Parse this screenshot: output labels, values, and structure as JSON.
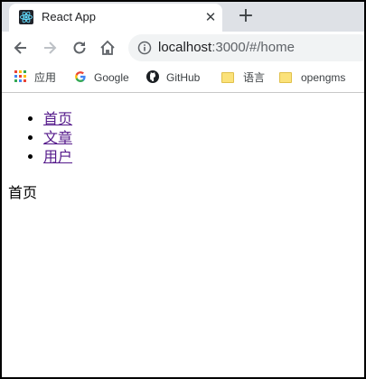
{
  "tab": {
    "title": "React App",
    "close": "✕"
  },
  "new_tab": "+",
  "address": {
    "host": "localhost",
    "rest": ":3000/#/home"
  },
  "bookmarks": [
    {
      "label": "应用",
      "icon": "apps-grid-icon"
    },
    {
      "label": "Google",
      "icon": "google-g-icon"
    },
    {
      "label": "GitHub",
      "icon": "github-icon"
    },
    {
      "label": "语言",
      "icon": "folder-icon"
    },
    {
      "label": "opengms",
      "icon": "folder-icon"
    }
  ],
  "nav": {
    "items": [
      {
        "label": "首页"
      },
      {
        "label": "文章"
      },
      {
        "label": "用户"
      }
    ]
  },
  "content": {
    "text": "首页"
  },
  "colors": {
    "tab_strip": "#dee1e6",
    "link": "#551a8b",
    "omnibox": "#f1f3f4"
  }
}
